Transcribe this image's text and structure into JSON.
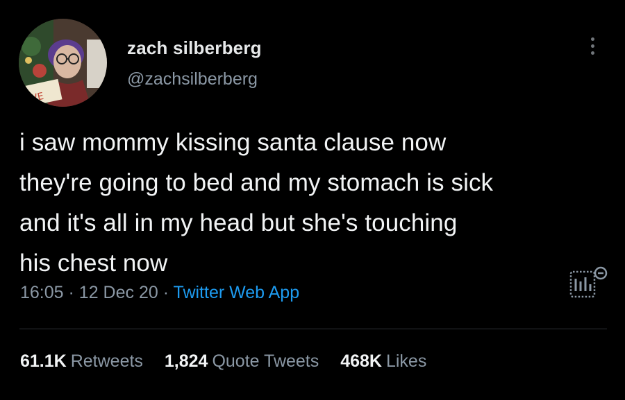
{
  "user": {
    "display_name": "zach silberberg",
    "handle": "@zachsilberberg"
  },
  "tweet": {
    "lines": [
      "i saw mommy kissing santa clause now",
      "they're going to bed and my stomach is sick",
      "and it's all in my head but she's touching",
      "his chest now"
    ],
    "time": "16:05",
    "separator": "·",
    "date": "12 Dec 20",
    "source": "Twitter Web App"
  },
  "stats": {
    "retweets": {
      "count": "61.1K",
      "label": "Retweets"
    },
    "quotes": {
      "count": "1,824",
      "label": "Quote Tweets"
    },
    "likes": {
      "count": "468K",
      "label": "Likes"
    }
  },
  "icons": {
    "more": "more-vertical-icon",
    "analytics": "analytics-icon"
  },
  "colors": {
    "background": "#000000",
    "text": "#e7e9ea",
    "secondary": "#8b98a5",
    "link": "#1d9bf0",
    "divider": "#2f3336"
  }
}
